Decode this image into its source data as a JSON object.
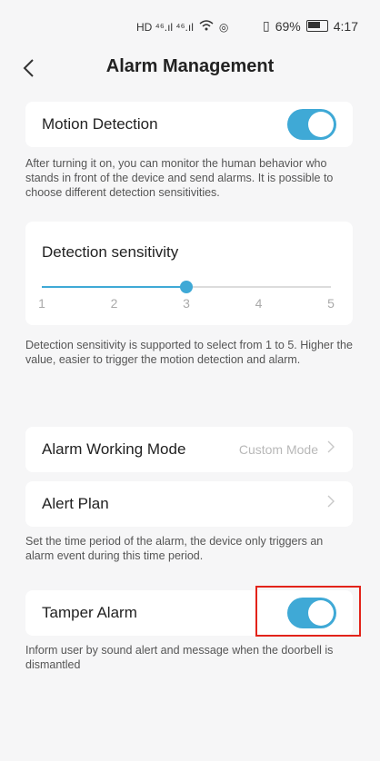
{
  "status_bar": {
    "network": "HD  ⁴⁶.ıl  ⁴⁶.ıl",
    "battery_percent": "69%",
    "time": "4:17"
  },
  "header": {
    "title": "Alarm Management"
  },
  "motion_detection": {
    "label": "Motion Detection",
    "enabled": true,
    "description": "After turning it on, you can monitor the human behavior who stands in front of the device and send alarms. It is possible to choose different detection sensitivities."
  },
  "sensitivity": {
    "label": "Detection sensitivity",
    "ticks": [
      "1",
      "2",
      "3",
      "4",
      "5"
    ],
    "value": 3,
    "description": "Detection sensitivity is supported to select from 1 to 5. Higher the value, easier to trigger the motion detection and alarm."
  },
  "working_mode": {
    "label": "Alarm Working Mode",
    "value": "Custom Mode"
  },
  "alert_plan": {
    "label": "Alert Plan",
    "description": "Set the time period of the alarm, the device only triggers an alarm event during this time period."
  },
  "tamper_alarm": {
    "label": "Tamper Alarm",
    "enabled": true,
    "description": "Inform user by sound alert and message when the doorbell is dismantled"
  },
  "colors": {
    "accent": "#3fa9d6",
    "highlight": "#e2231a"
  }
}
